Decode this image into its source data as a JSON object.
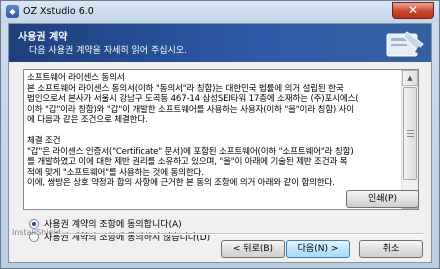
{
  "window": {
    "title": "OZ Xstudio 6.0",
    "close_label": "✕"
  },
  "banner": {
    "title": "사용권 계약",
    "subtitle": "다음 사용권 계약을 자세히 읽어 주십시오."
  },
  "license": {
    "text": "소프트웨어 라이센스 동의서\n본 소프트웨어 라이센스 동의서(이하 \"동의서\"라 칭함)는 대한민국 법률에 의거 설립된 한국\n법인으로서 본사가 서울시 강남구 도곡동 467-14 삼성SEI타워 17층에 소재하는 (주)포시에스(\n이하 \"갑\"이라 칭함)와 \"갑\"이 개발한 소프트웨어를 사용하는 사용자(이하 \"을\"이라 칭함) 사이\n에 다음과 같은 조건으로 체결한다.\n\n체결 조건\n\"갑\"은 라이센스 인증서(\"Certificate\" 문서)에 포함된 소프트웨어(이하 \"소프트웨어\"라 칭함)\n를 개발하였고 이에 대한 제반 권리를 소유하고 있으며, \"을\"이 아래에 기술된 제반 조건과 목\n적에 맞게 \"소프트웨어\"를 사용하는 것에 동의한다.\n이에, 쌍방은 상호 약정과 합의 사항에 근거한 본 동의 조항에 의거 아래와 같이 합의한다."
  },
  "options": {
    "accept": "사용권 계약의 조항에 동의합니다(A)",
    "decline": "사용권 계약의 조항에 동의하지 않습니다(D)",
    "selected": "accept"
  },
  "buttons": {
    "print": "인쇄(P)",
    "back": "< 뒤로(B)",
    "next": "다음(N) >",
    "cancel": "취소"
  },
  "footer": {
    "brand": "InstallShield"
  }
}
